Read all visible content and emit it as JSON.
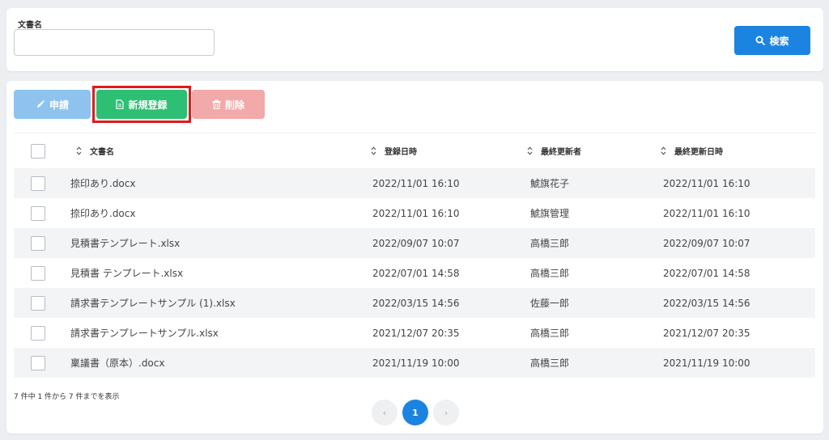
{
  "search": {
    "field_label": "文書名",
    "input_value": "",
    "button_label": "検索"
  },
  "toolbar": {
    "apply_label": "申請",
    "new_label": "新規登録",
    "delete_label": "削除"
  },
  "table": {
    "headers": {
      "name": "文書名",
      "registered": "登録日時",
      "updater": "最終更新者",
      "updated": "最終更新日時"
    },
    "rows": [
      {
        "name": "捺印あり.docx",
        "registered": "2022/11/01 16:10",
        "updater": "鯱旗花子",
        "updated": "2022/11/01 16:10"
      },
      {
        "name": "捺印あり.docx",
        "registered": "2022/11/01 16:10",
        "updater": "鯱旗管理",
        "updated": "2022/11/01 16:10"
      },
      {
        "name": "見積書テンプレート.xlsx",
        "registered": "2022/09/07 10:07",
        "updater": "高橋三郎",
        "updated": "2022/09/07 10:07"
      },
      {
        "name": "見積書 テンプレート.xlsx",
        "registered": "2022/07/01 14:58",
        "updater": "高橋三郎",
        "updated": "2022/07/01 14:58"
      },
      {
        "name": "請求書テンプレートサンプル (1).xlsx",
        "registered": "2022/03/15 14:56",
        "updater": "佐藤一郎",
        "updated": "2022/03/15 14:56"
      },
      {
        "name": "請求書テンプレートサンプル.xlsx",
        "registered": "2021/12/07 20:35",
        "updater": "高橋三郎",
        "updated": "2021/12/07 20:35"
      },
      {
        "name": "稟議書（原本）.docx",
        "registered": "2021/11/19 10:00",
        "updater": "高橋三郎",
        "updated": "2021/11/19 10:00"
      }
    ]
  },
  "summary": "7 件中 1 件から 7 件までを表示",
  "pagination": {
    "prev": "‹",
    "current": "1",
    "next": "›"
  },
  "colors": {
    "primary": "#1b84e0",
    "success": "#2dbf73",
    "apply_disabled": "#8ec3ef",
    "delete_disabled": "#f2a9a9",
    "highlight": "#e0191e"
  }
}
